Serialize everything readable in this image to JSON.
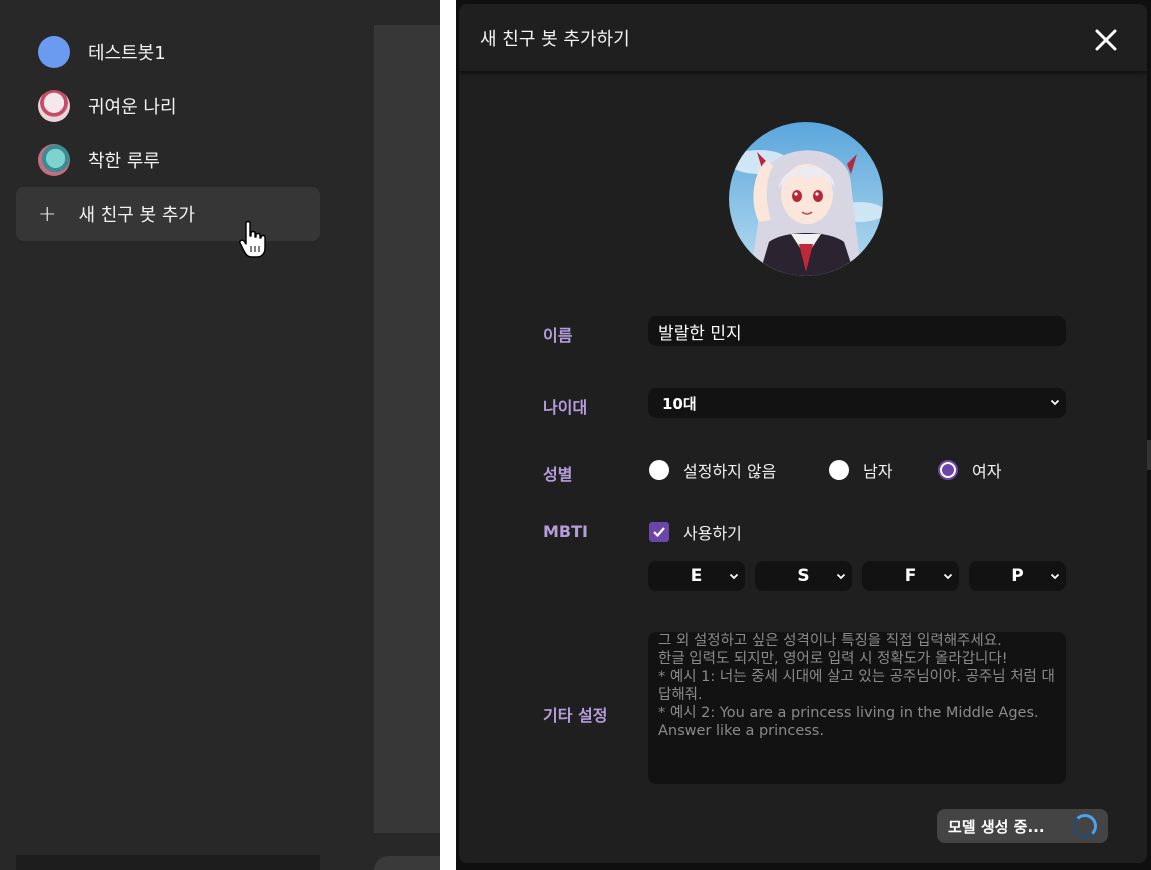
{
  "sidebar": {
    "items": [
      {
        "label": "테스트봇1",
        "avatar": "blue-circle-avatar"
      },
      {
        "label": "귀여운 나리",
        "avatar": "anime-girl-avatar"
      },
      {
        "label": "착한 루루",
        "avatar": "anime-girl-teal-avatar"
      }
    ],
    "add_item": {
      "icon": "plus-icon",
      "label": "새 친구 봇 추가"
    }
  },
  "modal": {
    "title": "새 친구 봇 추가하기",
    "close_icon": "close-icon",
    "avatar": "anime-girl-portrait",
    "form": {
      "name": {
        "label": "이름",
        "value": "발랄한 민지"
      },
      "age": {
        "label": "나이대",
        "value": "10대"
      },
      "gender": {
        "label": "성별",
        "options": [
          "설정하지 않음",
          "남자",
          "여자"
        ],
        "selected": "여자"
      },
      "mbti": {
        "label": "MBTI",
        "toggle_label": "사용하기",
        "enabled": true,
        "values": [
          "E",
          "S",
          "F",
          "P"
        ]
      },
      "extra": {
        "label": "기타 설정",
        "placeholder": "그 외 설정하고 싶은 성격이나 특징을 직접 입력해주세요.\n한글 입력도 되지만, 영어로 입력 시 정확도가 올라갑니다!\n* 예시 1: 너는 중세 시대에 살고 있는 공주님이야. 공주님 처럼 대답해줘.\n* 예시 2: You are a princess living in the Middle Ages. Answer like a princess."
      }
    },
    "status": {
      "label": "모델 생성 중...",
      "icon": "loading-spinner-icon"
    }
  },
  "colors": {
    "accent_purple": "#6b46a8",
    "label_purple": "#b59ddb",
    "spinner_blue": "#4aa3f0"
  }
}
